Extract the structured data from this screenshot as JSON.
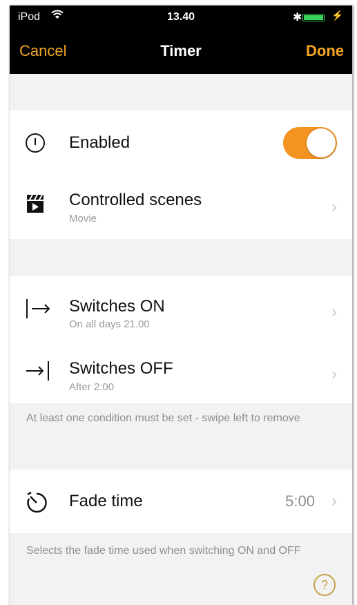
{
  "status": {
    "carrier": "iPod",
    "time": "13.40"
  },
  "nav": {
    "cancel": "Cancel",
    "title": "Timer",
    "done": "Done"
  },
  "accent_color": "#f39321",
  "enabled": {
    "label": "Enabled",
    "on": true
  },
  "scenes": {
    "label": "Controlled scenes",
    "subtitle": "Movie"
  },
  "switches_on": {
    "label": "Switches ON",
    "subtitle": "On all days  21.00"
  },
  "switches_off": {
    "label": "Switches OFF",
    "subtitle": "After 2:00"
  },
  "conditions_footer": "At least one condition must be set - swipe left to remove",
  "fade": {
    "label": "Fade time",
    "value": "5:00"
  },
  "fade_footer": "Selects the fade time used when switching ON and OFF",
  "help": "?"
}
